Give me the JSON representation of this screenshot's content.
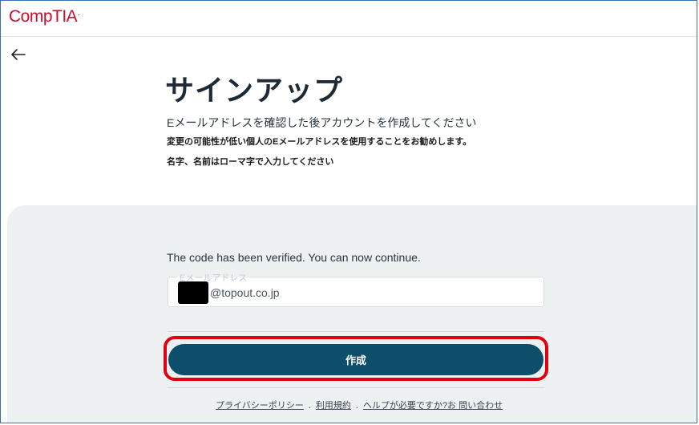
{
  "header": {
    "logo_text": "CompTIA",
    "logo_mark": "."
  },
  "nav": {
    "back_icon": "arrow-left-icon"
  },
  "main": {
    "title": "サインアップ",
    "subtitle": "Eメールアドレスを確認した後アカウントを作成してください",
    "note_1": "変更の可能性が低い個人のEメールアドレスを使用することをお勧めします。",
    "note_2": "名字、名前はローマ字で入力してください"
  },
  "form": {
    "verified_message": "The code has been verified. You can now continue.",
    "email_label": "Eメールアドレス",
    "email_value": "@topout.co.jp",
    "create_button": "作成"
  },
  "footer": {
    "privacy": "プライバシーポリシー",
    "terms": "利用規約",
    "help": "ヘルプが必要ですか?お 問い合わせ",
    "separator": "."
  },
  "colors": {
    "brand": "#c8102e",
    "button": "#0d4f6a",
    "highlight": "#e0000f",
    "panel": "#eef1f1"
  }
}
